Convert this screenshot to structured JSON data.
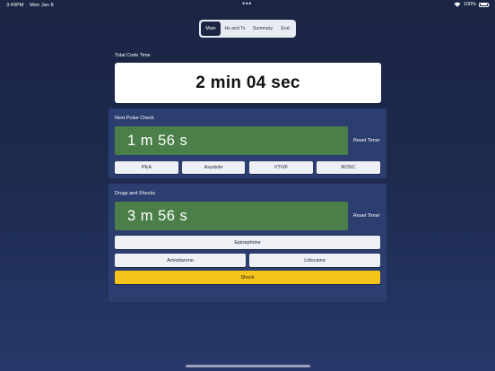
{
  "status_bar": {
    "time": "3:49PM",
    "date": "Mon Jan 8",
    "battery": "100%"
  },
  "tabs": [
    {
      "label": "Main",
      "active": true
    },
    {
      "label": "Hs and Ts",
      "active": false
    },
    {
      "label": "Summary",
      "active": false
    },
    {
      "label": "End",
      "active": false
    }
  ],
  "total_code": {
    "label": "Total Code Time",
    "value": "2 min 04 sec"
  },
  "pulse_check": {
    "label": "Next Pulse Check",
    "timer": "1 m 56 s",
    "reset_label": "Reset Timer",
    "rhythm_buttons": [
      "PEA",
      "Asystole",
      "VT/VF",
      "ROSC"
    ]
  },
  "drugs": {
    "label": "Drugs and Shocks",
    "timer": "3 m 56 s",
    "reset_label": "Reset Timer",
    "epinephrine": "Epinephrine",
    "amiodarone": "Amiodarone",
    "lidocaine": "Lidocaine",
    "shock": "Shock"
  },
  "colors": {
    "background": "#1d2a4d",
    "panel": "#2c3d6f",
    "timer_green": "#4b7f49",
    "shock_yellow": "#f6c31b"
  }
}
